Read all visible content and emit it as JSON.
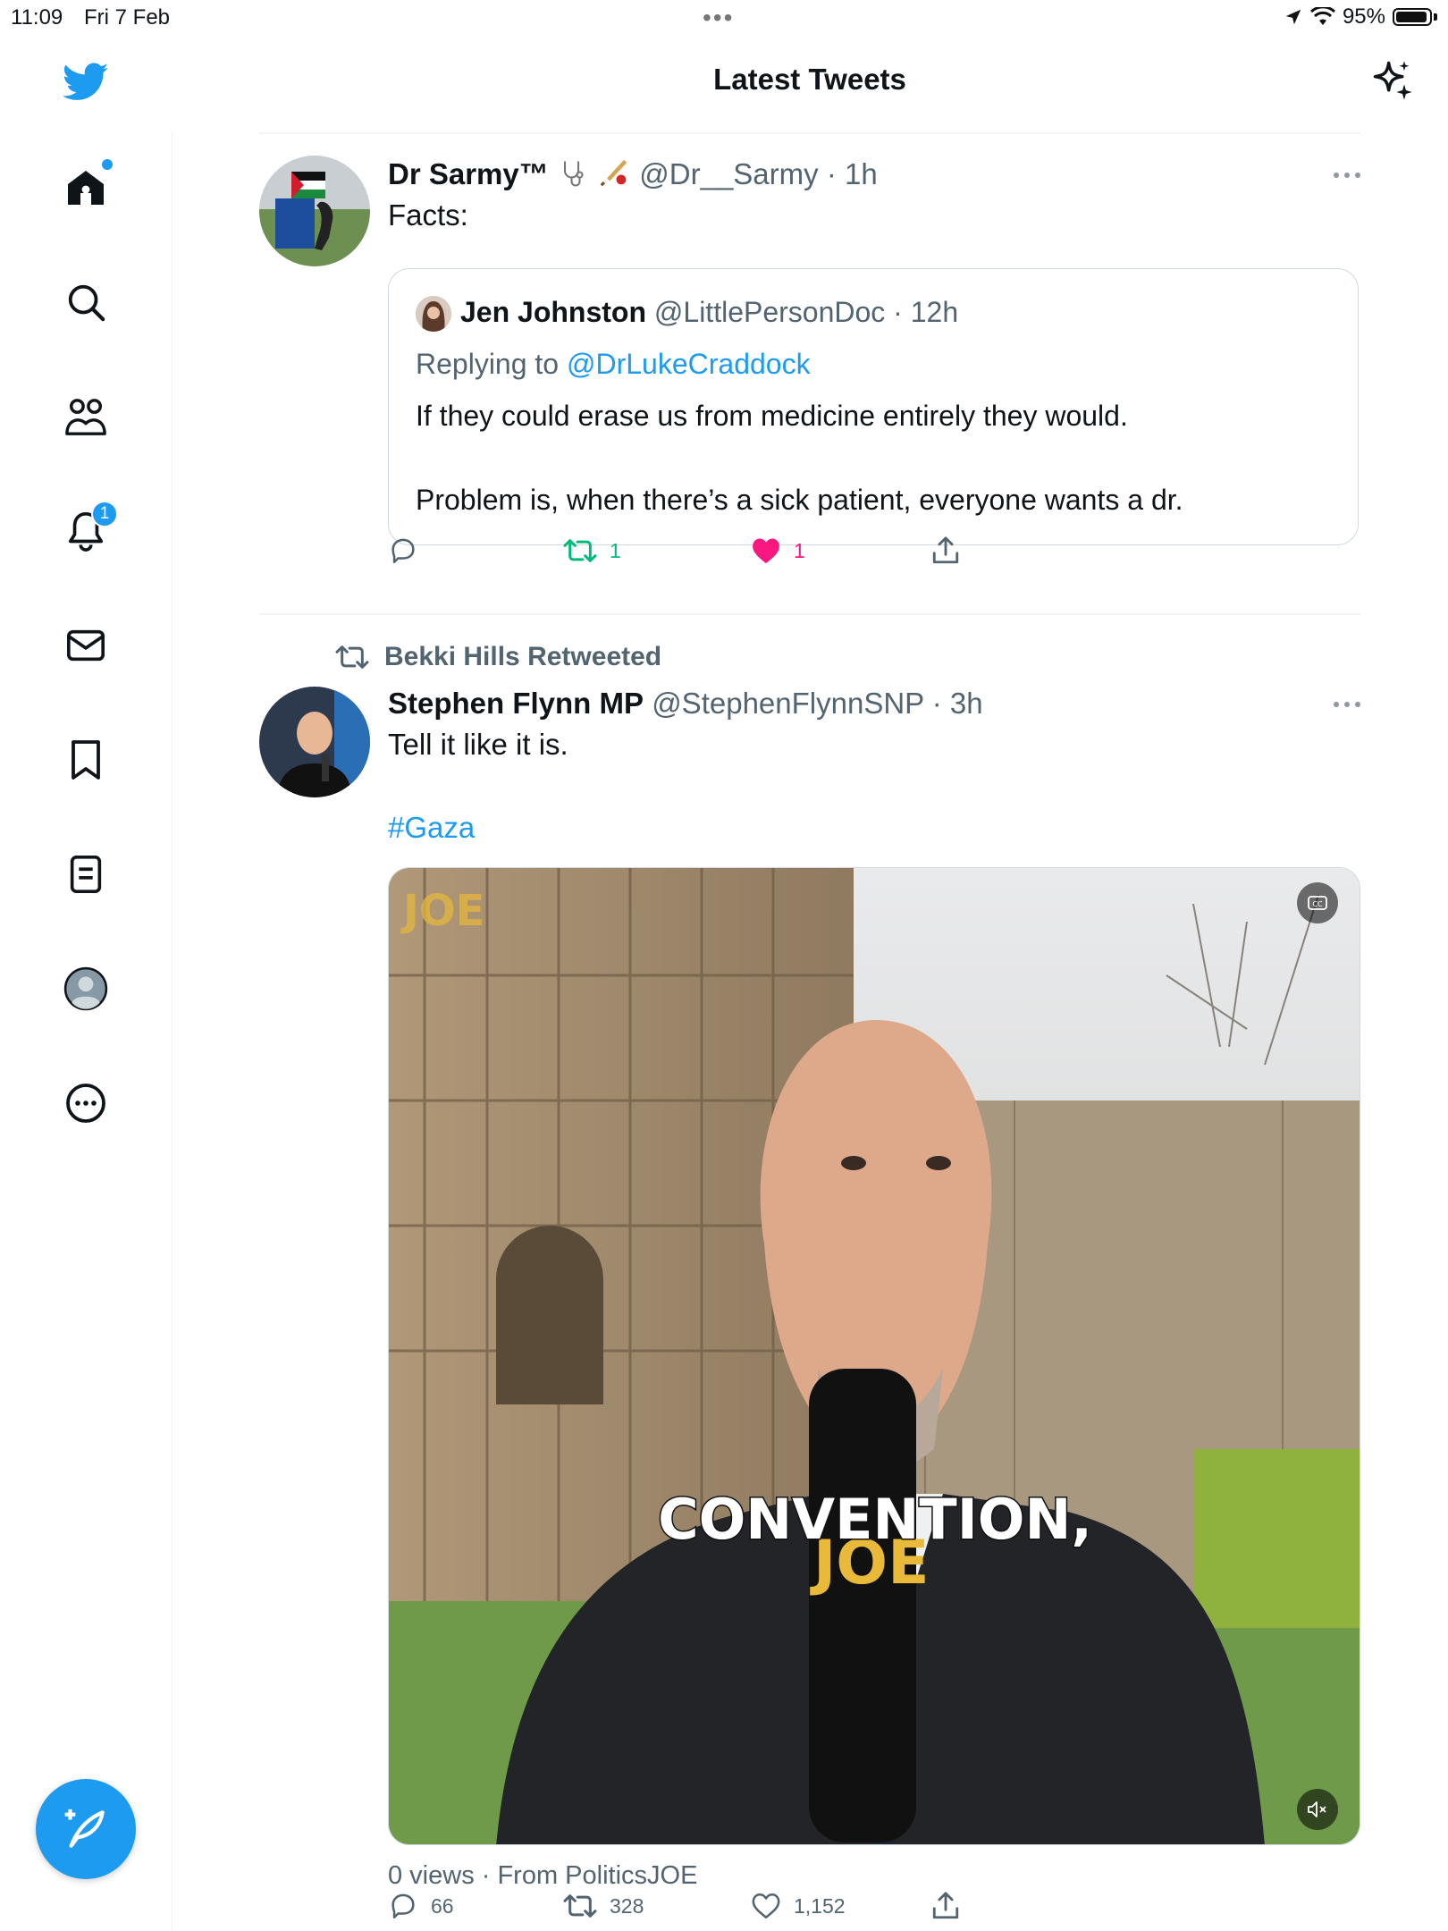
{
  "status": {
    "time": "11:09",
    "date": "Fri 7 Feb",
    "battery": "95%",
    "battery_level": 0.95
  },
  "header": {
    "title": "Latest Tweets"
  },
  "sidebar": {
    "notification_count": "1"
  },
  "tweets": [
    {
      "name": "Dr Sarmy™",
      "handle": "@Dr__Sarmy",
      "time": "· 1h",
      "text": "Facts:",
      "quote": {
        "name": "Jen Johnston",
        "handle": "@LittlePersonDoc",
        "time": "· 12h",
        "replying_prefix": "Replying to ",
        "replying_to": "@DrLukeCraddock",
        "text1": "If they could erase us from medicine entirely they would.",
        "text2": "Problem is, when there’s a sick patient, everyone wants a dr."
      },
      "retweets": "1",
      "likes": "1"
    },
    {
      "retweeted_by": "Bekki Hills Retweeted",
      "name": "Stephen Flynn MP",
      "handle": "@StephenFlynnSNP",
      "time": "· 3h",
      "text": "Tell it like it is.",
      "hashtag": "#Gaza",
      "video": {
        "caption": "CONVENTION,",
        "logo": "JOE",
        "mic_logo": "JOE"
      },
      "meta": "0 views · From PoliticsJOE",
      "replies": "66",
      "retweets": "328",
      "likes": "1,152"
    }
  ]
}
